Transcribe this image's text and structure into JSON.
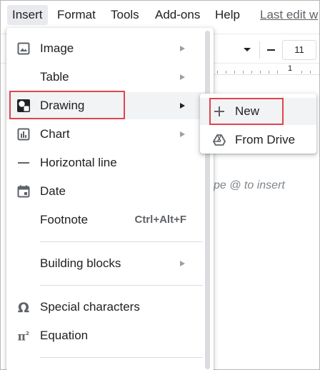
{
  "menubar": {
    "items": [
      "Insert",
      "Format",
      "Tools",
      "Add-ons",
      "Help"
    ],
    "last_edit": "Last edit w"
  },
  "toolbar": {
    "font_size": "11",
    "ruler_number": "1"
  },
  "document": {
    "hint": "ype @ to insert",
    "left_mark": "•"
  },
  "insert_menu": {
    "items": [
      {
        "label": "Image",
        "icon": "image-icon",
        "has_submenu": true
      },
      {
        "label": "Table",
        "icon": "",
        "has_submenu": true
      },
      {
        "label": "Drawing",
        "icon": "drawing-icon",
        "has_submenu": true,
        "highlighted": true
      },
      {
        "label": "Chart",
        "icon": "chart-icon",
        "has_submenu": true
      },
      {
        "label": "Horizontal line",
        "icon": "horizontal-line-icon",
        "has_submenu": false
      },
      {
        "label": "Date",
        "icon": "calendar-icon",
        "has_submenu": false
      },
      {
        "label": "Footnote",
        "icon": "",
        "shortcut": "Ctrl+Alt+F",
        "has_submenu": false
      },
      {
        "label": "Building blocks",
        "icon": "",
        "has_submenu": true
      },
      {
        "label": "Special characters",
        "icon": "omega-icon",
        "has_submenu": false
      },
      {
        "label": "Equation",
        "icon": "pi-squared-icon",
        "has_submenu": false
      }
    ]
  },
  "drawing_submenu": {
    "items": [
      {
        "label": "New",
        "icon": "plus-icon",
        "highlighted": true
      },
      {
        "label": "From Drive",
        "icon": "google-drive-icon"
      }
    ]
  },
  "colors": {
    "highlight_border": "#e0444e",
    "hover_background": "#f1f3f4",
    "text": "#202124",
    "icon": "#5f6368"
  }
}
